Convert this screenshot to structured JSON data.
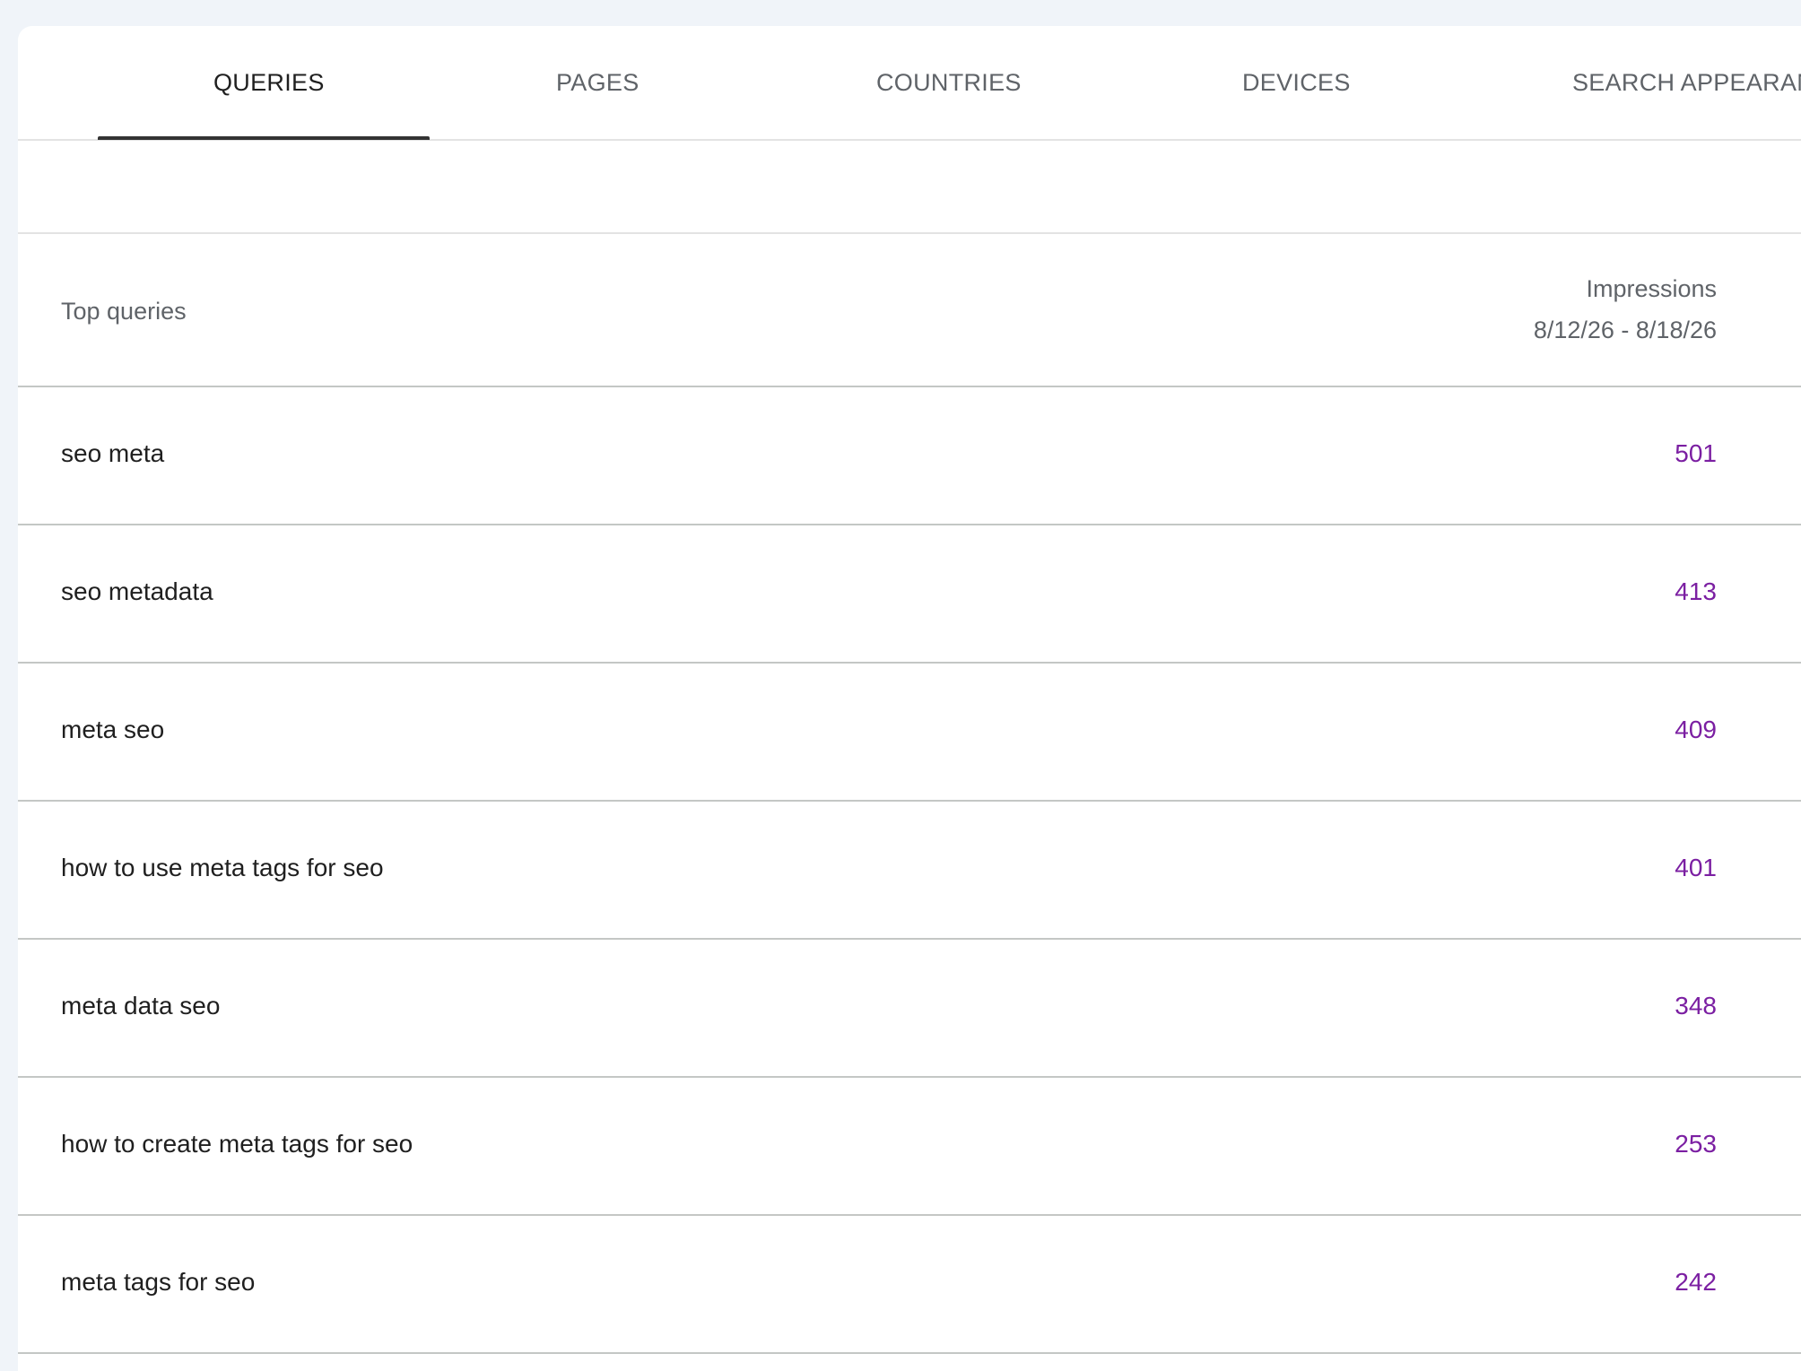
{
  "tabs": [
    {
      "label": "QUERIES",
      "active": true
    },
    {
      "label": "PAGES",
      "active": false
    },
    {
      "label": "COUNTRIES",
      "active": false
    },
    {
      "label": "DEVICES",
      "active": false
    },
    {
      "label": "SEARCH APPEARANCE",
      "active": false
    }
  ],
  "table": {
    "title": "Top queries",
    "metric_label": "Impressions",
    "date_range": "8/12/26 - 8/18/26",
    "rows": [
      {
        "query": "seo meta",
        "impressions": "501"
      },
      {
        "query": "seo metadata",
        "impressions": "413"
      },
      {
        "query": "meta seo",
        "impressions": "409"
      },
      {
        "query": "how to use meta tags for seo",
        "impressions": "401"
      },
      {
        "query": "meta data seo",
        "impressions": "348"
      },
      {
        "query": "how to create meta tags for seo",
        "impressions": "253"
      },
      {
        "query": "meta tags for seo",
        "impressions": "242"
      }
    ]
  },
  "colors": {
    "value_purple": "#7b1fa2",
    "active_tab": "#1f1f1f",
    "inactive_tab": "#5f6368",
    "background": "#f0f4f9"
  }
}
